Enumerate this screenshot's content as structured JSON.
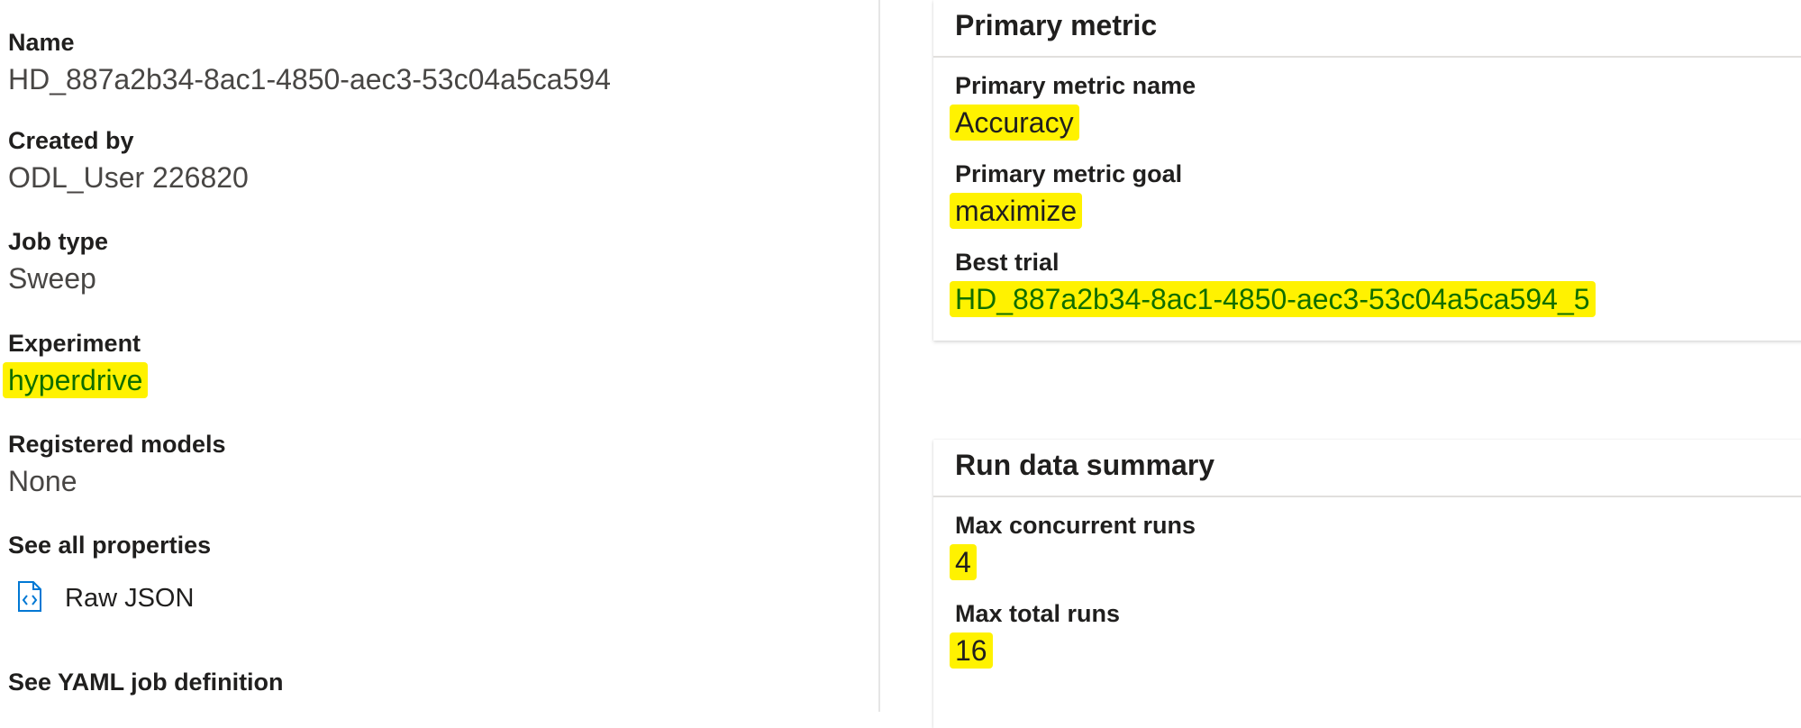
{
  "left_panel": {
    "name": {
      "label": "Name",
      "value": "HD_887a2b34-8ac1-4850-aec3-53c04a5ca594"
    },
    "created_by": {
      "label": "Created by",
      "value": "ODL_User 226820"
    },
    "job_type": {
      "label": "Job type",
      "value": "Sweep"
    },
    "experiment": {
      "label": "Experiment",
      "value": "hyperdrive"
    },
    "registered_models": {
      "label": "Registered models",
      "value": "None"
    },
    "see_all_properties": "See all properties",
    "raw_json": "Raw JSON",
    "see_yaml": "See YAML job definition"
  },
  "primary_metric_card": {
    "title": "Primary metric",
    "metric_name": {
      "label": "Primary metric name",
      "value": "Accuracy"
    },
    "metric_goal": {
      "label": "Primary metric goal",
      "value": "maximize"
    },
    "best_trial": {
      "label": "Best trial",
      "value": "HD_887a2b34-8ac1-4850-aec3-53c04a5ca594_5"
    }
  },
  "run_summary_card": {
    "title": "Run data summary",
    "max_concurrent": {
      "label": "Max concurrent runs",
      "value": "4"
    },
    "max_total": {
      "label": "Max total runs",
      "value": "16"
    }
  },
  "colors": {
    "highlight": "#fff200",
    "link": "#106e00",
    "icon": "#0078d4"
  },
  "icons": {
    "raw_json": "code-file-icon"
  }
}
